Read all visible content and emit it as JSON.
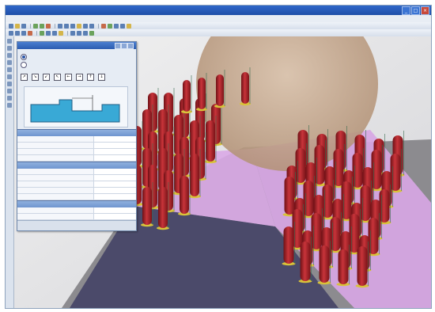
{
  "window": {
    "title": "",
    "buttons": [
      "_",
      "□",
      "×"
    ]
  },
  "menubar": {
    "items": []
  },
  "panel": {
    "title": "",
    "options": [
      {
        "label": "",
        "selected": true
      },
      {
        "label": "",
        "selected": false
      }
    ],
    "tool_icons": [
      "↗",
      "↘",
      "↙",
      "↖",
      "←",
      "→",
      "↑",
      "↓"
    ],
    "sketch_label": "",
    "groups": [
      {
        "title": "",
        "rows": [
          {
            "k": "",
            "v": ""
          },
          {
            "k": "",
            "v": ""
          },
          {
            "k": "",
            "v": ""
          },
          {
            "k": "",
            "v": ""
          }
        ]
      },
      {
        "title": "",
        "rows": [
          {
            "k": "",
            "v": ""
          },
          {
            "k": "",
            "v": ""
          },
          {
            "k": "",
            "v": ""
          },
          {
            "k": "",
            "v": ""
          },
          {
            "k": "",
            "v": ""
          }
        ]
      },
      {
        "title": "",
        "rows": [
          {
            "k": "",
            "v": ""
          },
          {
            "k": "",
            "v": ""
          },
          {
            "k": "",
            "v": ""
          }
        ]
      }
    ]
  },
  "viewport": {
    "axis_label": "",
    "colors": {
      "floor_grey": "#8c8b8f",
      "floor_dark": "#4b4a6a",
      "plate_pink": "#d9a9e6",
      "pin_red": "#b0252a",
      "tool_tan": "#c9a98d"
    }
  }
}
